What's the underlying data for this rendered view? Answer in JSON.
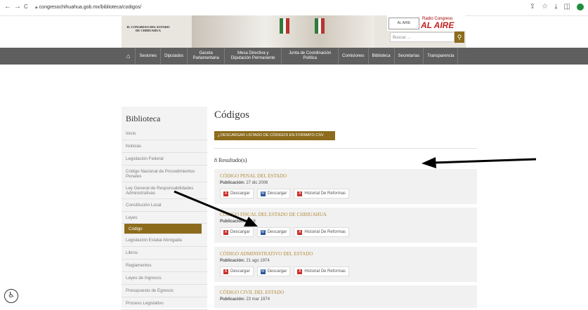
{
  "browser": {
    "url": "congresochihuahua.gob.mx/biblioteca/codigos/",
    "back": "←",
    "forward": "→",
    "reload": "C",
    "icons": [
      "share-icon",
      "star-icon",
      "download-icon",
      "sidebar-icon",
      "profile-icon"
    ]
  },
  "header": {
    "logo_line1": "H. CONGRESO DEL ESTADO",
    "logo_line2": "DE CHIHUAHUA",
    "radio_title": "Radio Congreso",
    "radio_name": "AL AIRE",
    "radio_logo": "AL AIRE",
    "search_placeholder": "Buscar ..."
  },
  "nav": {
    "items": [
      "Sesiones",
      "Diputados",
      "Gaceta Parlamentaria",
      "Mesa Directiva y Diputación Permanente",
      "Junta de Coordinación Política",
      "Comisiones",
      "Biblioteca",
      "Secretarías",
      "Transparencia"
    ]
  },
  "sidebar": {
    "title": "Biblioteca",
    "items": [
      "Inicio",
      "Noticias",
      "Legislación Federal",
      "Código Nacional de Procedimientos Penales",
      "Ley General de Responsabilidades Administrativas",
      "Constitución Local",
      "Leyes",
      "Código",
      "Legislación Estatal Abrogada",
      "Libros",
      "Reglamentos",
      "Leyes de Ingresos",
      "Presupuesto de Egresos",
      "Proceso Legislativo"
    ],
    "active_index": 7
  },
  "main": {
    "title": "Códigos",
    "csv_button": "DESCARGAR LISTADO DE CÓDIGOS EN FORMATO CSV",
    "results": "8 Resultado(s)",
    "pub_label": "Publicación:",
    "buttons": {
      "pdf": "Descargar",
      "word": "Descargar",
      "history": "Historial De Reformas"
    },
    "cards": [
      {
        "title": "CÓDIGO PENAL DEL ESTADO",
        "date": "27 dic 2006"
      },
      {
        "title": "CÓDIGO FISCAL DEL ESTADO DE CHIHUAHUA",
        "date": "2018"
      },
      {
        "title": "CÓDIGO ADMINISTRATIVO DEL ESTADO",
        "date": "21 ago 1974"
      },
      {
        "title": "CÓDIGO CIVIL DEL ESTADO",
        "date": "23 mar 1974"
      }
    ]
  },
  "accessibility_icon": "accessibility-icon"
}
